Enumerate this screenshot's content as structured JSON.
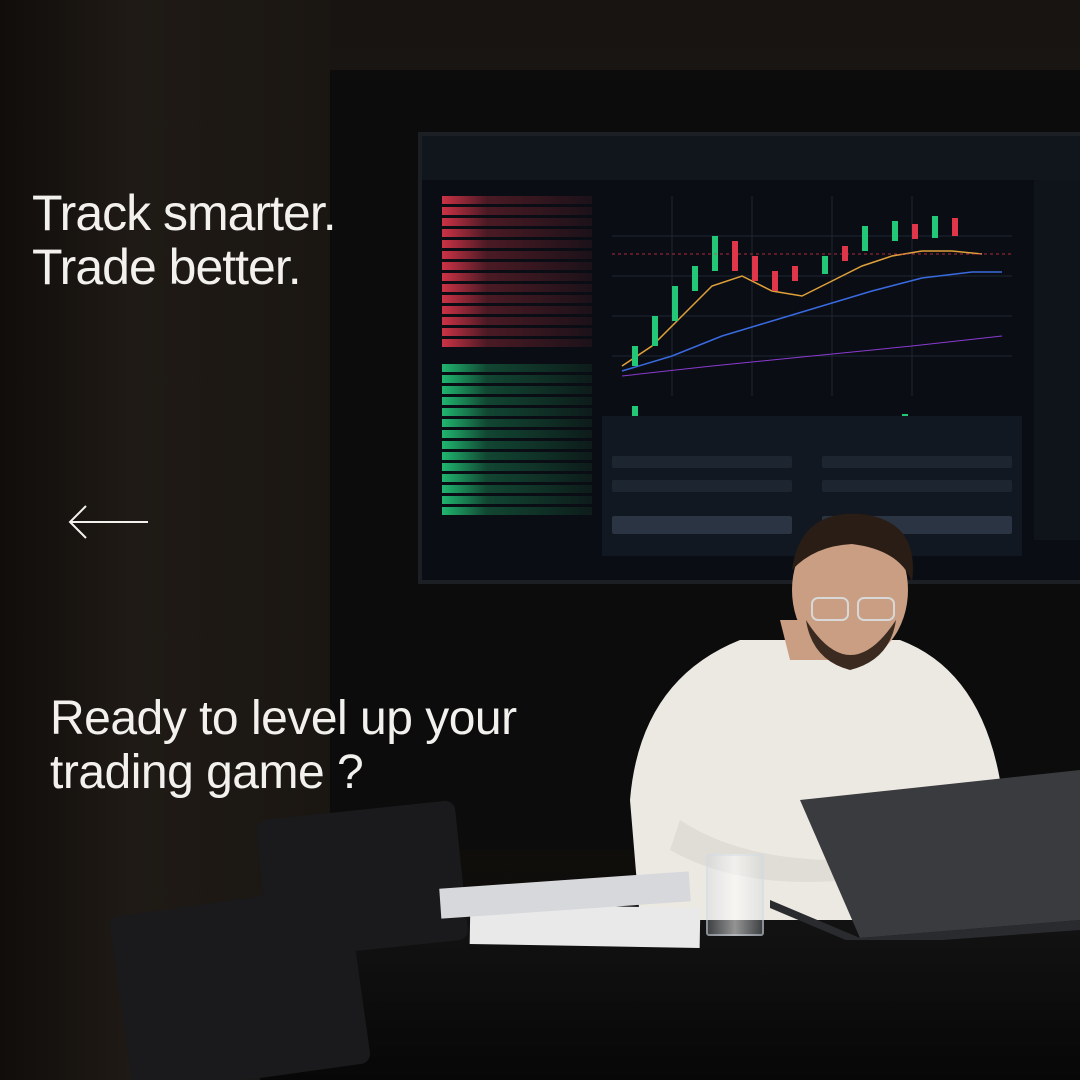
{
  "headline": {
    "line1": "Track smarter.",
    "line2": "Trade better."
  },
  "cta": {
    "line1": "Ready to level up your",
    "line2": "trading game ?"
  },
  "icons": {
    "back": "left-arrow-icon"
  },
  "colors": {
    "text": "#f3f1ee",
    "up": "#22c878",
    "down": "#e0364a"
  }
}
